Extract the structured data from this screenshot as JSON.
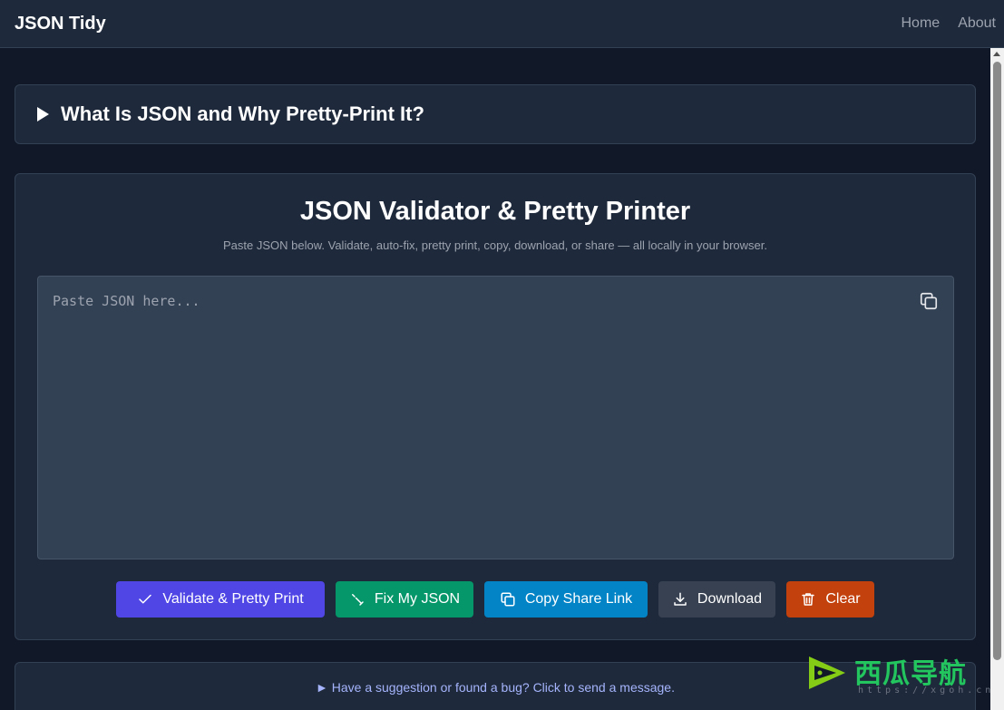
{
  "navbar": {
    "brand": "JSON Tidy",
    "links": [
      "Home",
      "About"
    ]
  },
  "faq": {
    "title": "What Is JSON and Why Pretty-Print It?"
  },
  "main": {
    "title": "JSON Validator & Pretty Printer",
    "subtitle": "Paste JSON below. Validate, auto-fix, pretty print, copy, download, or share — all locally in your browser.",
    "editor_placeholder": "Paste JSON here...",
    "editor_value": ""
  },
  "buttons": {
    "validate": "Validate & Pretty Print",
    "fix": "Fix My JSON",
    "share": "Copy Share Link",
    "download": "Download",
    "clear": "Clear"
  },
  "feedback": {
    "text": "► Have a suggestion or found a bug? Click to send a message."
  },
  "watermark": {
    "text": "西瓜导航",
    "url": "https://xgoh.cn"
  },
  "colors": {
    "background": "#111827",
    "card": "#1e293b",
    "validate": "#4f46e5",
    "fix": "#059669",
    "share": "#0284c7",
    "download": "#374151",
    "clear": "#c2410c"
  }
}
